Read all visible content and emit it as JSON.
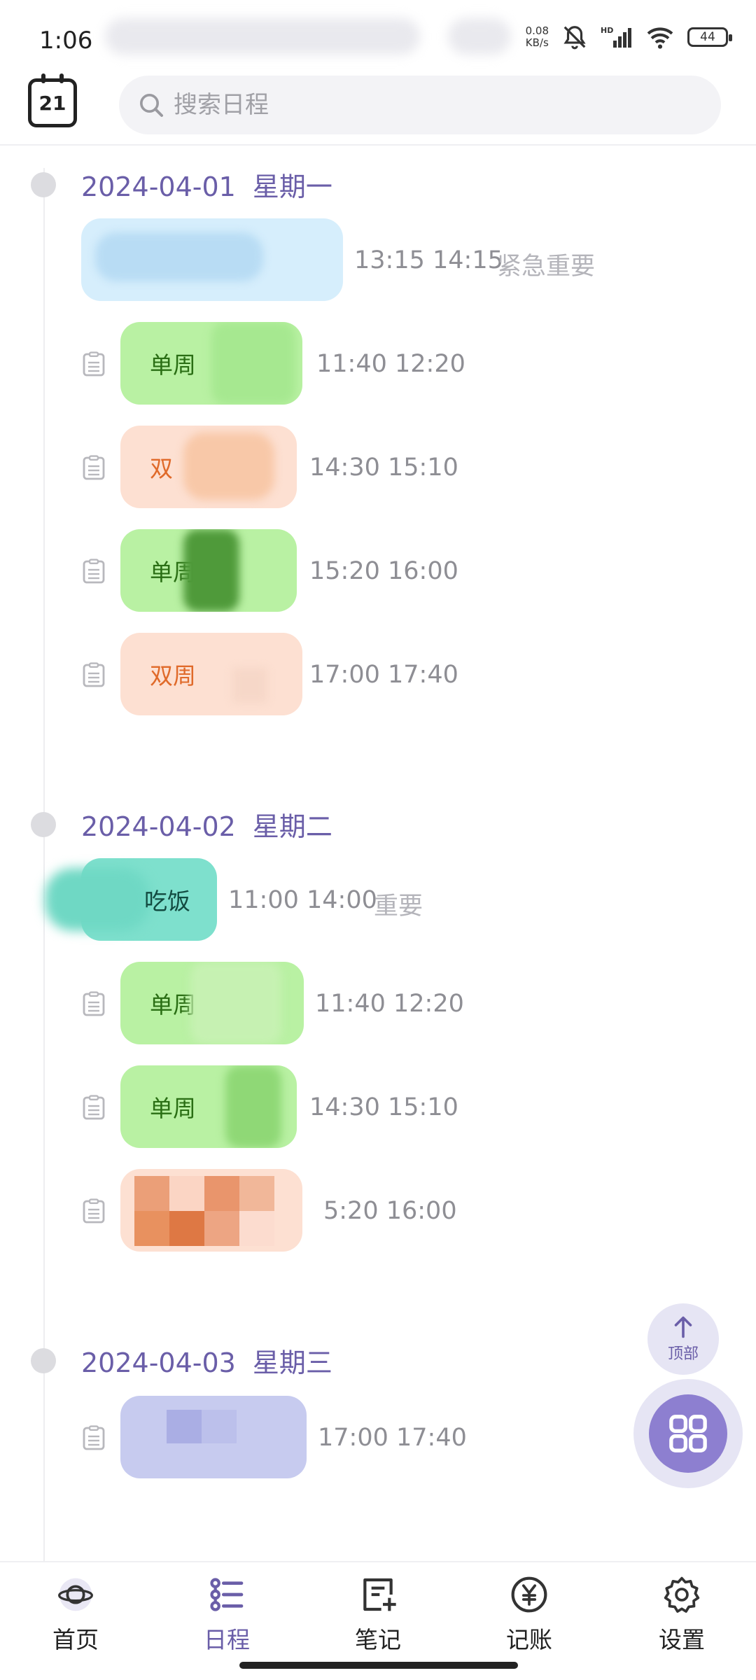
{
  "status_bar": {
    "time": "1:06",
    "net_speed_value": "0.08",
    "net_speed_unit": "KB/s",
    "battery": "44"
  },
  "header": {
    "search_placeholder": "搜索日程",
    "calendar_icon_text": "21"
  },
  "days": [
    {
      "date": "2024-04-01",
      "weekday": "星期一",
      "events": [
        {
          "label": "",
          "times": "13:15 14:15",
          "tag": "紧急重要",
          "color": "blue",
          "note": false
        },
        {
          "label": "单周",
          "times": "11:40 12:20",
          "tag": "",
          "color": "green",
          "note": true
        },
        {
          "label": "双",
          "times": "14:30 15:10",
          "tag": "",
          "color": "orange",
          "note": true
        },
        {
          "label": "单周",
          "times": "15:20 16:00",
          "tag": "",
          "color": "green",
          "note": true
        },
        {
          "label": "双周",
          "times": "17:00 17:40",
          "tag": "",
          "color": "orange",
          "note": true
        }
      ]
    },
    {
      "date": "2024-04-02",
      "weekday": "星期二",
      "events": [
        {
          "label": "吃饭",
          "times": "11:00 14:00",
          "tag": "重要",
          "color": "teal",
          "note": false
        },
        {
          "label": "单周",
          "times": "11:40 12:20",
          "tag": "",
          "color": "green",
          "note": true
        },
        {
          "label": "单周",
          "times": "14:30 15:10",
          "tag": "",
          "color": "green",
          "note": true
        },
        {
          "label": "",
          "times": "5:20 16:00",
          "tag": "",
          "color": "orange",
          "note": true
        }
      ]
    },
    {
      "date": "2024-04-03",
      "weekday": "星期三",
      "events": [
        {
          "label": "",
          "times": "17:00 17:40",
          "tag": "",
          "color": "lavender",
          "note": true
        }
      ]
    }
  ],
  "fab": {
    "top_label": "顶部"
  },
  "nav": [
    {
      "label": "首页",
      "icon": "planet-icon",
      "active": false
    },
    {
      "label": "日程",
      "icon": "schedule-list-icon",
      "active": true
    },
    {
      "label": "笔记",
      "icon": "note-edit-icon",
      "active": false
    },
    {
      "label": "记账",
      "icon": "yuan-coin-icon",
      "active": false
    },
    {
      "label": "设置",
      "icon": "gear-icon",
      "active": false
    }
  ],
  "colors": {
    "accent": "#6a5ea8",
    "fab": "#8d7fd0"
  }
}
